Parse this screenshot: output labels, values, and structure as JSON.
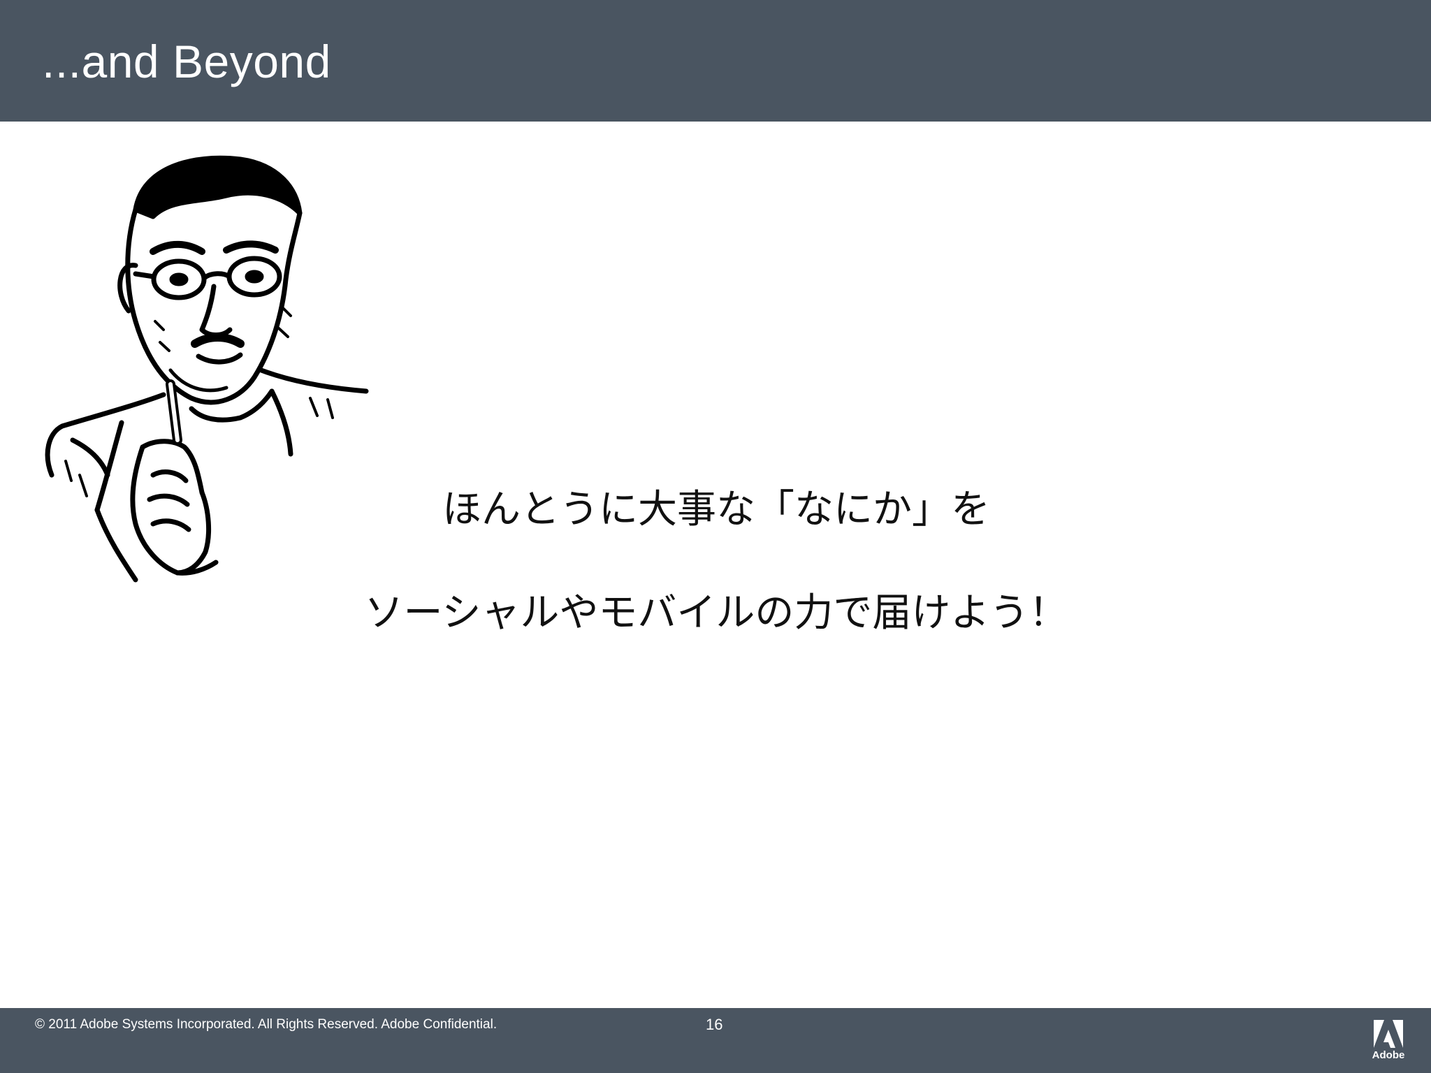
{
  "header": {
    "title": "...and Beyond"
  },
  "illustration": {
    "icon": "retro-man-holding-cigarette-illustration"
  },
  "body": {
    "lines": [
      "ほんとうに大事な「なにか」を",
      "ソーシャルやモバイルの力で届けよう！"
    ]
  },
  "footer": {
    "copyright": "© 2011 Adobe Systems Incorporated.  All Rights Reserved.  Adobe Confidential.",
    "page_number": "16",
    "logo_text": "Adobe"
  },
  "colors": {
    "bar": "#4a5561",
    "background": "#ffffff",
    "text": "#111111"
  }
}
